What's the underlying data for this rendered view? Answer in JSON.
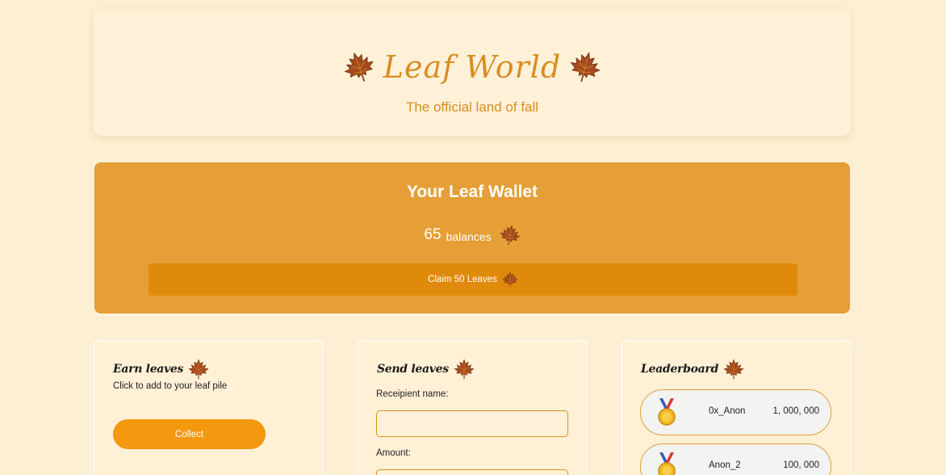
{
  "header": {
    "title": "Leaf World",
    "subtitle": "The official land of fall"
  },
  "wallet": {
    "title": "Your Leaf Wallet",
    "balance": "65",
    "balance_unit": "balances",
    "claim_label": "Claim 50 Leaves"
  },
  "earn": {
    "heading": "Earn leaves",
    "description": "Click to add to your leaf pile",
    "collect_label": "Collect"
  },
  "send": {
    "heading": "Send leaves",
    "recipient_label": "Receipient name:",
    "recipient_value": "",
    "amount_label": "Amount:",
    "amount_value": ""
  },
  "leaderboard": {
    "heading": "Leaderboard",
    "entries": [
      {
        "name": "0x_Anon",
        "score": "1, 000, 000"
      },
      {
        "name": "Anon_2",
        "score": "100, 000"
      }
    ]
  },
  "colors": {
    "background": "#fdefd4",
    "accent": "#e59f36",
    "button": "#f4980f",
    "title": "#d88d22"
  },
  "icons": {
    "leaf": "maple-leaf-icon",
    "medal": "gold-medal-icon"
  }
}
